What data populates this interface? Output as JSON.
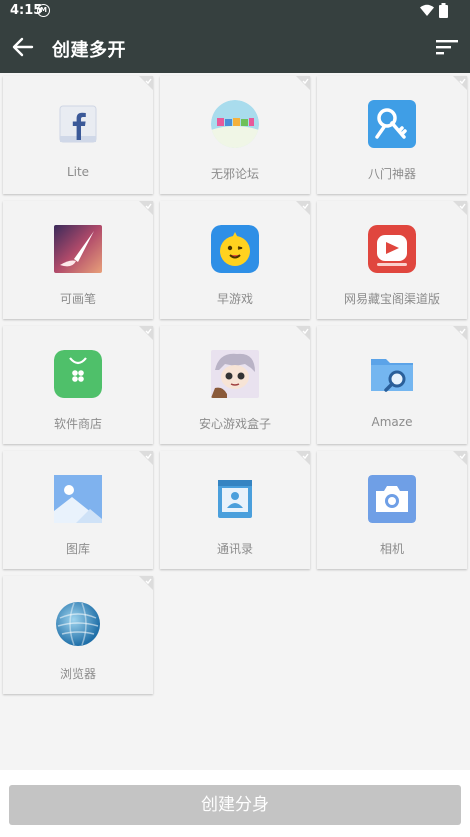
{
  "status": {
    "time": "4:15",
    "badge": "M"
  },
  "appbar": {
    "title": "创建多开"
  },
  "apps": [
    {
      "label": "Lite",
      "icon": "facebook-icon"
    },
    {
      "label": "无邪论坛",
      "icon": "wuxie-forum-icon"
    },
    {
      "label": "八门神器",
      "icon": "bamen-key-icon"
    },
    {
      "label": "可画笔",
      "icon": "brush-icon"
    },
    {
      "label": "早游戏",
      "icon": "zao-game-icon"
    },
    {
      "label": "网易藏宝阁渠道版",
      "icon": "netease-treasure-icon"
    },
    {
      "label": "软件商店",
      "icon": "app-store-icon"
    },
    {
      "label": "安心游戏盒子",
      "icon": "anime-game-box-icon"
    },
    {
      "label": "Amaze",
      "icon": "folder-search-icon"
    },
    {
      "label": "图库",
      "icon": "gallery-icon"
    },
    {
      "label": "通讯录",
      "icon": "contacts-icon"
    },
    {
      "label": "相机",
      "icon": "camera-icon"
    },
    {
      "label": "浏览器",
      "icon": "browser-icon"
    }
  ],
  "footer": {
    "create_label": "创建分身"
  },
  "colors": {
    "appbar": "#36403f",
    "tile": "#f3f3f3",
    "button_disabled": "#c4c4c4"
  }
}
